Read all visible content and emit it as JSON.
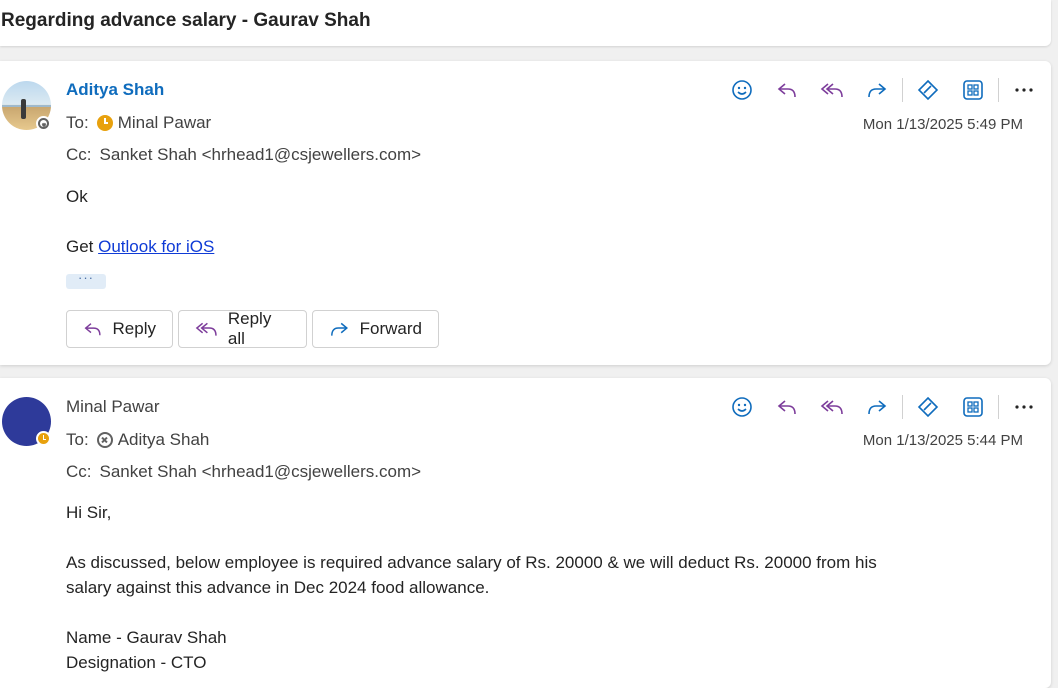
{
  "subject": "Regarding advance salary - Gaurav Shah",
  "toolbar_icons": [
    "emoji-icon",
    "reply-icon",
    "reply-all-icon",
    "forward-icon",
    "copilot-icon",
    "apps-icon",
    "more-icon"
  ],
  "colors": {
    "accent": "#0f6cbd",
    "purple": "#7d3d9b",
    "away": "#e8a10d",
    "avatar_blue": "#2e3a9a"
  },
  "messages": [
    {
      "sender": "Aditya Shah",
      "to_label": "To:",
      "to": "Minal Pawar",
      "cc_label": "Cc:",
      "cc": "Sanket Shah <hrhead1@csjewellers.com>",
      "timestamp": "Mon 1/13/2025 5:49 PM",
      "body": "Ok",
      "signature_prefix": "Get ",
      "signature_link": "Outlook for iOS",
      "more": "···",
      "actions": {
        "reply": "Reply",
        "reply_all": "Reply all",
        "forward": "Forward"
      }
    },
    {
      "sender": "Minal Pawar",
      "to_label": "To:",
      "to": "Aditya Shah",
      "cc_label": "Cc:",
      "cc": "Sanket Shah <hrhead1@csjewellers.com>",
      "timestamp": "Mon 1/13/2025 5:44 PM",
      "greeting": "Hi Sir,",
      "para_line1": "As discussed, below employee is required advance salary of Rs. 20000 & we will deduct Rs. 20000 from his",
      "para_line2": "salary against this advance in Dec 2024 food allowance.",
      "name_line": "Name - Gaurav Shah",
      "designation_line": "Designation - CTO"
    }
  ]
}
